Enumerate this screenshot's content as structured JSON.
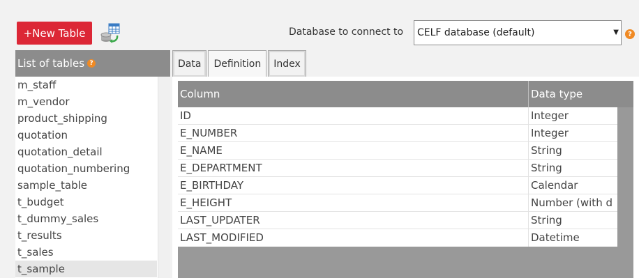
{
  "toolbar": {
    "new_table_label": "+New Table",
    "db_icon": "database-table-icon",
    "db_label": "Database to connect to",
    "db_selected": "CELF database (default)",
    "help_glyph": "?"
  },
  "tables_panel": {
    "title": "List of tables",
    "items": [
      "m_staff",
      "m_vendor",
      "product_shipping",
      "quotation",
      "quotation_detail",
      "quotation_numbering",
      "sample_table",
      "t_budget",
      "t_dummy_sales",
      "t_results",
      "t_sales",
      "t_sample"
    ],
    "selected": "t_sample"
  },
  "tabs": [
    {
      "label": "Data"
    },
    {
      "label": "Definition"
    },
    {
      "label": "Index"
    }
  ],
  "active_tab": "Definition",
  "definition": {
    "columns": [
      "Column",
      "Data type"
    ],
    "rows": [
      {
        "column": "ID",
        "type": "Integer"
      },
      {
        "column": "E_NUMBER",
        "type": "Integer"
      },
      {
        "column": "E_NAME",
        "type": "String"
      },
      {
        "column": "E_DEPARTMENT",
        "type": "String"
      },
      {
        "column": "E_BIRTHDAY",
        "type": "Calendar"
      },
      {
        "column": "E_HEIGHT",
        "type": "Number (with d"
      },
      {
        "column": "LAST_UPDATER",
        "type": "String"
      },
      {
        "column": "LAST_MODIFIED",
        "type": "Datetime"
      }
    ]
  },
  "colors": {
    "accent": "#dc2736",
    "header_gray": "#8c8c8c",
    "help_orange": "#f08a24"
  }
}
